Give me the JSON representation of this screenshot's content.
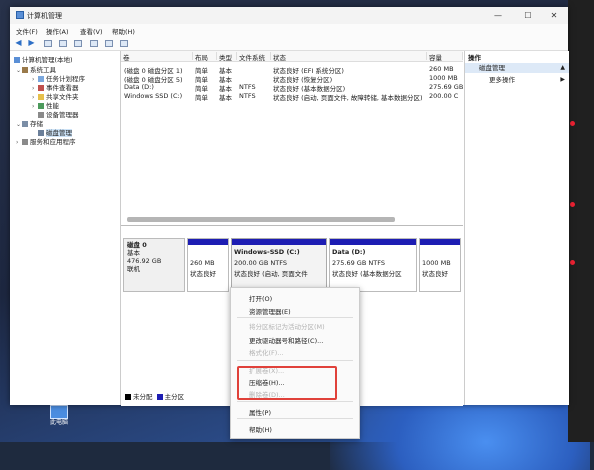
{
  "window": {
    "title": "计算机管理",
    "controls": {
      "minimize": "—",
      "maximize": "☐",
      "close": "✕"
    }
  },
  "menubar": {
    "file": "文件(F)",
    "action": "操作(A)",
    "view": "查看(V)",
    "help": "帮助(H)"
  },
  "toolbar": {
    "back": "◀",
    "forward": "▶"
  },
  "tree": {
    "root": "计算机管理(本地)",
    "system_tools": "系统工具",
    "task_scheduler": "任务计划程序",
    "event_viewer": "事件查看器",
    "shared_folders": "共享文件夹",
    "performance": "性能",
    "device_manager": "设备管理器",
    "storage": "存储",
    "disk_management": "磁盘管理",
    "services_apps": "服务和应用程序"
  },
  "volume_list": {
    "columns": [
      "卷",
      "布局",
      "类型",
      "文件系统",
      "状态",
      "容量"
    ],
    "rows": [
      {
        "volume": "(磁盘 0 磁盘分区 1)",
        "layout": "简单",
        "type": "基本",
        "fs": "",
        "status": "状态良好 (EFI 系统分区)",
        "capacity": "260 MB"
      },
      {
        "volume": "(磁盘 0 磁盘分区 5)",
        "layout": "简单",
        "type": "基本",
        "fs": "",
        "status": "状态良好 (恢复分区)",
        "capacity": "1000 MB"
      },
      {
        "volume": "Data (D:)",
        "layout": "简单",
        "type": "基本",
        "fs": "NTFS",
        "status": "状态良好 (基本数据分区)",
        "capacity": "275.69 GB"
      },
      {
        "volume": "Windows SSD (C:)",
        "layout": "简单",
        "type": "基本",
        "fs": "NTFS",
        "status": "状态良好 (启动, 页面文件, 故障转储, 基本数据分区)",
        "capacity": "200.00 C"
      }
    ]
  },
  "disk_view": {
    "disk": {
      "name": "磁盘 0",
      "type": "基本",
      "size": "476.92 GB",
      "state": "联机"
    },
    "partitions": [
      {
        "title": "",
        "size": "260 MB",
        "status": "状态良好"
      },
      {
        "title": "Windows-SSD (C:)",
        "size": "200.00 GB NTFS",
        "status": "状态良好 (启动, 页面文件"
      },
      {
        "title": "Data (D:)",
        "size": "275.69 GB NTFS",
        "status": "状态良好 (基本数据分区"
      },
      {
        "title": "",
        "size": "1000 MB",
        "status": "状态良好"
      }
    ],
    "legend": {
      "unallocated": "未分配",
      "primary": "主分区"
    }
  },
  "actions": {
    "header": "操作",
    "section": "磁盘管理",
    "more": "更多操作",
    "arrow_up": "▲",
    "arrow_right": "▶"
  },
  "context_menu": {
    "open": "打开(O)",
    "explore": "资源管理器(E)",
    "mark_active": "将分区标记为活动分区(M)",
    "change_letter": "更改驱动器号和路径(C)...",
    "format": "格式化(F)...",
    "extend": "扩展卷(X)...",
    "shrink": "压缩卷(H)...",
    "delete": "删除卷(D)...",
    "properties": "属性(P)",
    "help": "帮助(H)"
  },
  "desktop": {
    "icon_label": "此电脑"
  },
  "colors": {
    "accent": "#1d1db3",
    "highlight_box": "#e0413a",
    "selection": "#cde3f7"
  }
}
